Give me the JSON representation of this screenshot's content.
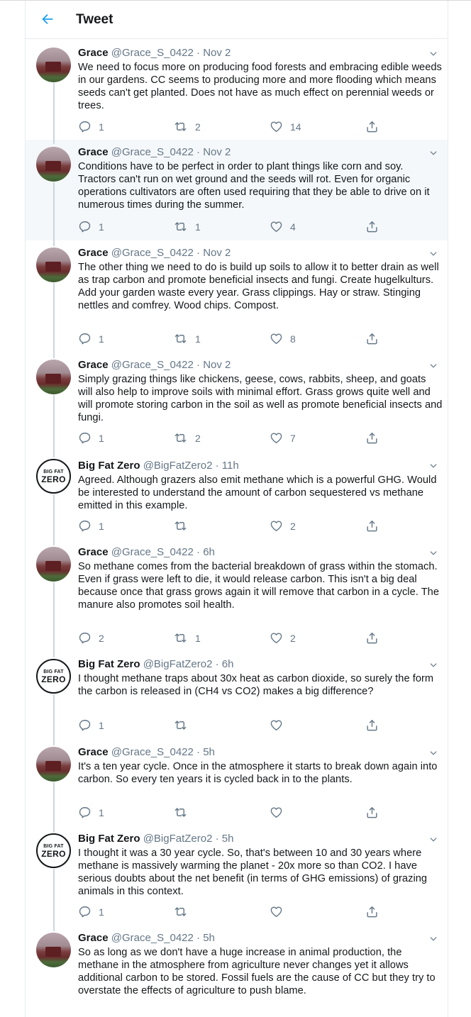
{
  "header": {
    "title": "Tweet",
    "back_icon": "back-arrow-icon"
  },
  "colors": {
    "accent": "#1da1f2",
    "secondary_text": "#657786",
    "highlight_bg": "#f5f8fa"
  },
  "tweets": [
    {
      "name": "Grace",
      "handle": "@Grace_S_0422",
      "time": "Nov 2",
      "text": "We need to focus more on producing food forests and embracing edible weeds in our gardens. CC seems to producing more and more flooding which means seeds can't get planted. Does not have as much effect on perennial weeds or trees.",
      "replies": "1",
      "retweets": "2",
      "likes": "14"
    },
    {
      "name": "Grace",
      "handle": "@Grace_S_0422",
      "time": "Nov 2",
      "text": "Conditions have to be perfect in order to plant things like corn and soy. Tractors can't run on wet ground and the seeds will rot. Even for organic operations cultivators are often used requiring that they be able to drive on it numerous times during the summer.",
      "replies": "1",
      "retweets": "1",
      "likes": "4"
    },
    {
      "name": "Grace",
      "handle": "@Grace_S_0422",
      "time": "Nov 2",
      "text": "The other thing we need to do is build up soils to allow it to better drain as well as trap carbon and promote beneficial insects and fungi. Create hugelkulturs. Add your garden waste every year. Grass clippings. Hay or straw. Stinging nettles and comfrey. Wood chips. Compost.",
      "replies": "1",
      "retweets": "1",
      "likes": "8"
    },
    {
      "name": "Grace",
      "handle": "@Grace_S_0422",
      "time": "Nov 2",
      "text": "Simply grazing things like chickens, geese, cows, rabbits, sheep, and goats will also help to improve soils with minimal effort. Grass grows quite well and will promote storing carbon in the soil as well as promote beneficial insects and fungi.",
      "replies": "1",
      "retweets": "2",
      "likes": "7"
    },
    {
      "name": "Big Fat Zero",
      "handle": "@BigFatZero2",
      "time": "11h",
      "avatar_text": [
        "BIG FAT",
        "ZERO"
      ],
      "text": "Agreed. Although grazers also emit methane which is a powerful GHG. Would be interested to understand the amount of carbon sequestered vs methane emitted in this example.",
      "replies": "1",
      "retweets": "",
      "likes": "2"
    },
    {
      "name": "Grace",
      "handle": "@Grace_S_0422",
      "time": "6h",
      "text": "So methane comes from the bacterial breakdown of grass within the stomach. Even if grass were left to die, it would release carbon. This isn't a big deal because once that grass grows again it will remove that carbon in a cycle. The manure also promotes soil health.",
      "replies": "2",
      "retweets": "1",
      "likes": "2"
    },
    {
      "name": "Big Fat Zero",
      "handle": "@BigFatZero2",
      "time": "6h",
      "avatar_text": [
        "BIG FAT",
        "ZERO"
      ],
      "text": "I thought methane traps about 30x heat as carbon dioxide, so surely the form the carbon is released in (CH4 vs CO2) makes a big difference?",
      "replies": "1",
      "retweets": "",
      "likes": ""
    },
    {
      "name": "Grace",
      "handle": "@Grace_S_0422",
      "time": "5h",
      "text": "It's a ten year cycle. Once in the atmosphere it starts to break down again into carbon. So every ten years it is cycled back in to the plants.",
      "replies": "1",
      "retweets": "",
      "likes": ""
    },
    {
      "name": "Big Fat Zero",
      "handle": "@BigFatZero2",
      "time": "5h",
      "avatar_text": [
        "BIG FAT",
        "ZERO"
      ],
      "text": "I thought it was a 30 year cycle. So, that's between 10 and 30 years where methane is massively warming the planet - 20x more so than CO2. I have serious doubts about the net benefit (in terms of GHG emissions) of grazing animals in this context.",
      "replies": "1",
      "retweets": "",
      "likes": ""
    },
    {
      "name": "Grace",
      "handle": "@Grace_S_0422",
      "time": "5h",
      "text": "So as long as we don't have a huge increase in animal production, the methane in the atmosphere from agriculture never changes yet it allows additional carbon to be stored. Fossil fuels are the cause of CC but they try to overstate the effects of agriculture to push blame.",
      "replies": "",
      "retweets": "",
      "likes": ""
    }
  ]
}
